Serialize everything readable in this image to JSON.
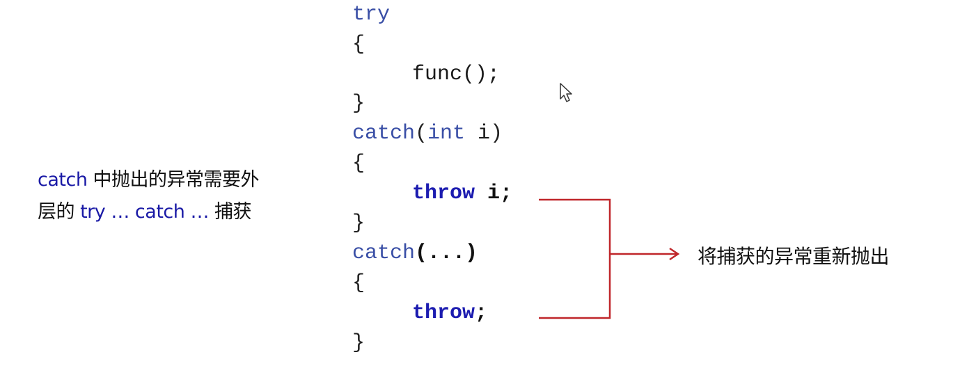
{
  "explanation": {
    "line1_kw": "catch",
    "line1_rest": " 中抛出的异常需要外",
    "line2_prefix": "层的 ",
    "line2_kw1": "try … catch …",
    "line2_suffix": " 捕获"
  },
  "code": {
    "l1": "try",
    "l2": "{",
    "l3": "func();",
    "l4": "}",
    "l5_kw": "catch",
    "l5_open": "(",
    "l5_type": "int",
    "l5_var": " i",
    "l5_close": ")",
    "l6": "{",
    "l7_kw": "throw",
    "l7_var": " i",
    "l7_semi": ";",
    "l8": "}",
    "l9_kw": "catch",
    "l9_args": "(...)",
    "l10": "{",
    "l11_kw": "throw",
    "l11_semi": ";",
    "l12": "}"
  },
  "annotation": {
    "text": "将捕获的异常重新抛出"
  },
  "colors": {
    "keyword": "#3a4fa6",
    "bold_keyword": "#1c1cb0",
    "arrow": "#c0262a",
    "text": "#111111"
  },
  "icons": {
    "cursor": "mouse-pointer-icon",
    "arrow": "arrow-right-icon"
  }
}
